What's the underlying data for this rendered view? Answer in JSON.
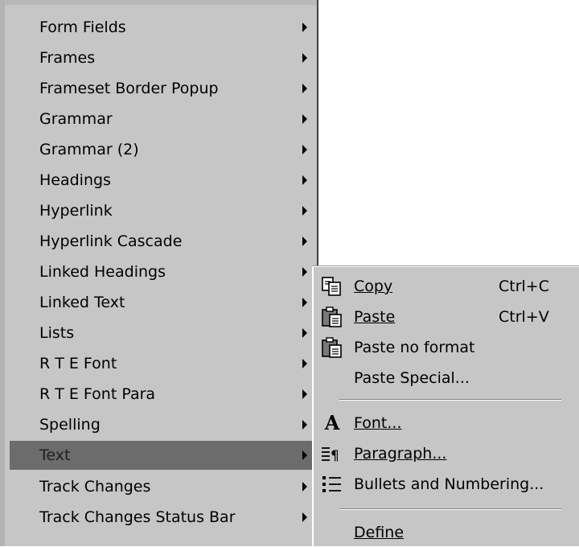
{
  "main_menu": {
    "items": [
      {
        "label": "Form Fields"
      },
      {
        "label": "Frames"
      },
      {
        "label": "Frameset Border Popup"
      },
      {
        "label": "Grammar"
      },
      {
        "label": "Grammar (2)"
      },
      {
        "label": "Headings"
      },
      {
        "label": "Hyperlink"
      },
      {
        "label": "Hyperlink Cascade"
      },
      {
        "label": "Linked Headings"
      },
      {
        "label": "Linked Text"
      },
      {
        "label": "Lists"
      },
      {
        "label": "R T E Font"
      },
      {
        "label": "R T E Font Para"
      },
      {
        "label": "Spelling"
      },
      {
        "label": "Text"
      },
      {
        "label": "Track Changes"
      },
      {
        "label": "Track Changes Status Bar"
      }
    ],
    "selected": "Text"
  },
  "context_menu": {
    "copy": {
      "label": "Copy",
      "shortcut": "Ctrl+C",
      "icon": "copy-icon"
    },
    "paste": {
      "label": "Paste",
      "shortcut": "Ctrl+V",
      "icon": "paste-icon"
    },
    "paste_no_format": {
      "label": "Paste no format",
      "icon": "paste-icon"
    },
    "paste_special": {
      "label": "Paste Special..."
    },
    "font": {
      "label": "Font...",
      "icon": "font-icon",
      "icon_glyph": "A"
    },
    "paragraph": {
      "label": "Paragraph...",
      "icon": "paragraph-icon"
    },
    "bullets": {
      "label": "Bullets and Numbering...",
      "icon": "bullets-icon"
    },
    "define": {
      "label": "Define"
    }
  },
  "colors": {
    "menu_bg": "#c6c6c6",
    "highlight": "#6c6c6c"
  }
}
